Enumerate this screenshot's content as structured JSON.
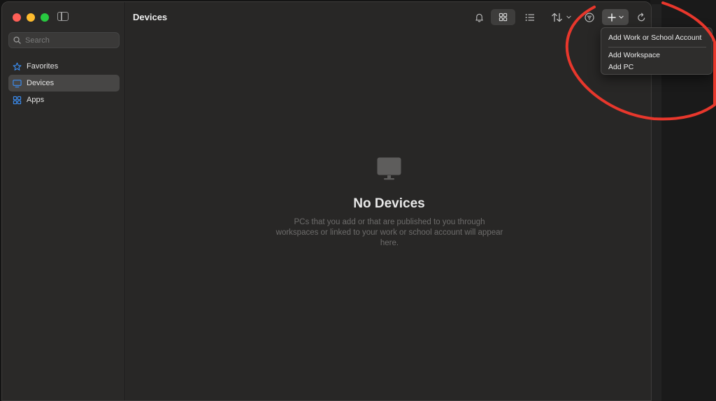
{
  "window": {
    "title": "Devices"
  },
  "sidebar": {
    "search": {
      "placeholder": "Search",
      "value": ""
    },
    "items": [
      {
        "label": "Favorites",
        "icon": "star-icon",
        "active": false
      },
      {
        "label": "Devices",
        "icon": "monitor-icon",
        "active": true
      },
      {
        "label": "Apps",
        "icon": "apps-grid-icon",
        "active": false
      }
    ]
  },
  "toolbar": {
    "icons": [
      "bell-icon",
      "grid-view-icon",
      "list-view-icon",
      "sort-icon",
      "filter-icon",
      "plus-icon",
      "refresh-icon"
    ]
  },
  "add_menu": {
    "items": [
      "Add Work or School Account",
      "Add Workspace",
      "Add PC"
    ]
  },
  "empty_state": {
    "title": "No Devices",
    "message": "PCs that you add or that are published to you through workspaces or linked to your work or school account will appear here."
  },
  "colors": {
    "accent": "#3b8ff6",
    "annotation": "#e8372c",
    "close": "#ff5f57",
    "minimize": "#febc2e",
    "maximize": "#28c840"
  }
}
